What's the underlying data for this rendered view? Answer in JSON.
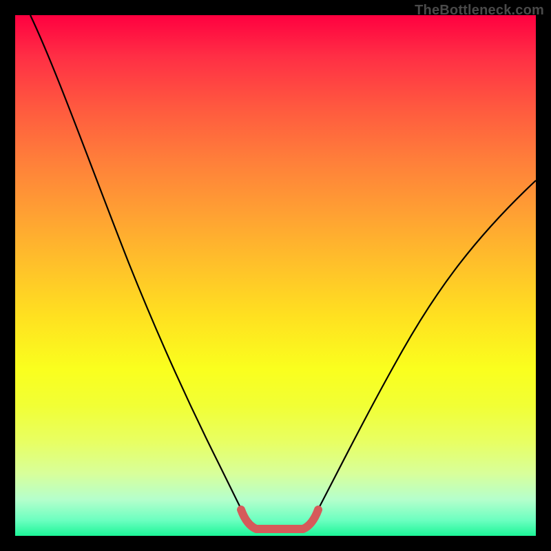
{
  "watermark": "TheBottleneck.com",
  "chart_data": {
    "type": "line",
    "title": "",
    "xlabel": "",
    "ylabel": "",
    "xlim": [
      0,
      100
    ],
    "ylim": [
      0,
      100
    ],
    "grid": false,
    "legend": false,
    "series": [
      {
        "name": "curve-left",
        "color": "#000000",
        "x": [
          3,
          8,
          13,
          18,
          23,
          28,
          33,
          38,
          42
        ],
        "values": [
          100,
          86,
          72,
          58,
          45,
          33,
          22,
          12,
          4
        ]
      },
      {
        "name": "curve-right",
        "color": "#000000",
        "x": [
          58,
          63,
          68,
          73,
          78,
          83,
          88,
          93,
          98,
          100
        ],
        "values": [
          4,
          10,
          17,
          24,
          32,
          40,
          48,
          56,
          64,
          68
        ]
      },
      {
        "name": "trough-flat",
        "color": "#d65a5a",
        "x": [
          42,
          45,
          48,
          52,
          55,
          58
        ],
        "values": [
          4,
          1.5,
          0.8,
          0.8,
          1.5,
          4
        ]
      }
    ],
    "gradient_stops": [
      {
        "pos": 0,
        "color": "#ff0040"
      },
      {
        "pos": 50,
        "color": "#ffd520"
      },
      {
        "pos": 100,
        "color": "#1cf598"
      }
    ]
  }
}
